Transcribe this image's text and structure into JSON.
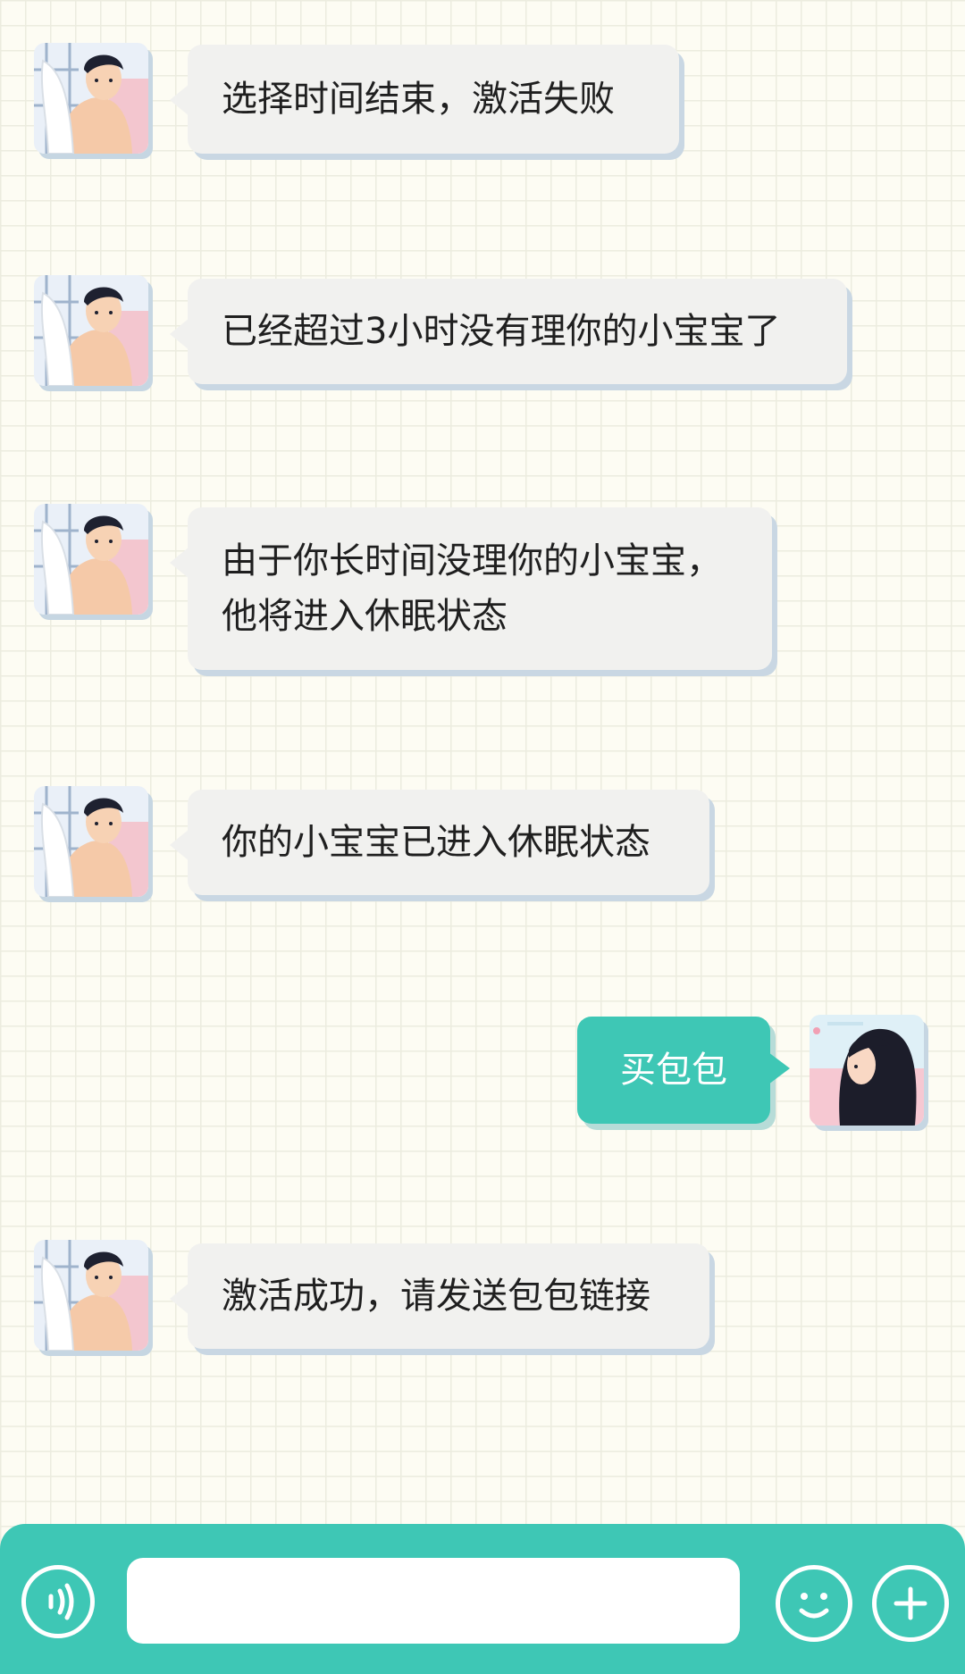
{
  "messages": [
    {
      "side": "left",
      "text": "选择时间结束，激活失败"
    },
    {
      "side": "left",
      "text": "已经超过3小时没有理你的小宝宝了"
    },
    {
      "side": "left",
      "text": "由于你长时间没理你的小宝宝，\n他将进入休眠状态"
    },
    {
      "side": "left",
      "text": "你的小宝宝已进入休眠状态"
    },
    {
      "side": "right",
      "text": "买包包"
    },
    {
      "side": "left",
      "text": "激活成功，请发送包包链接"
    }
  ],
  "input": {
    "placeholder": "",
    "value": ""
  },
  "icons": {
    "male_avatar": "man-with-towel-avatar",
    "female_avatar": "woman-long-hair-avatar",
    "voice": "voice-wave-icon",
    "emoji": "smiley-face-icon",
    "more": "plus-icon"
  },
  "colors": {
    "accent": "#3ec7b5",
    "bubble": "#f1f1ef",
    "bubble_shadow": "#c9d7e3",
    "background": "#fdfcf3"
  }
}
